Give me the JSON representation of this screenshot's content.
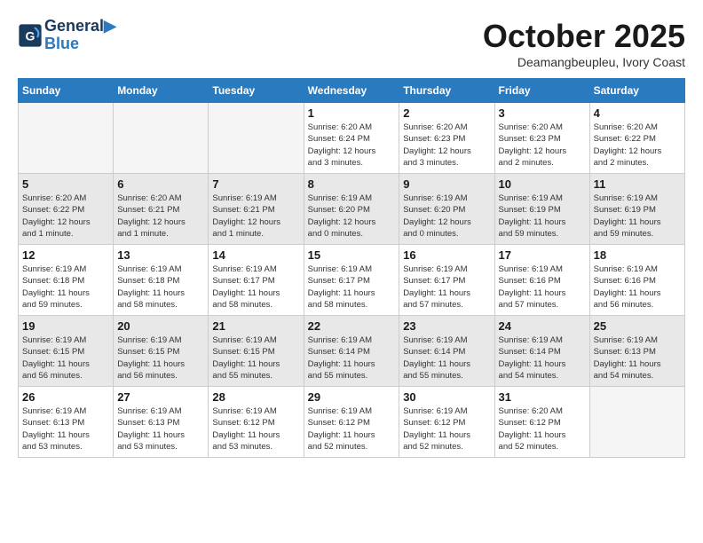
{
  "logo": {
    "line1": "General",
    "line2": "Blue"
  },
  "title": "October 2025",
  "location": "Deamangbeupleu, Ivory Coast",
  "headers": [
    "Sunday",
    "Monday",
    "Tuesday",
    "Wednesday",
    "Thursday",
    "Friday",
    "Saturday"
  ],
  "weeks": [
    [
      {
        "day": "",
        "text": ""
      },
      {
        "day": "",
        "text": ""
      },
      {
        "day": "",
        "text": ""
      },
      {
        "day": "1",
        "text": "Sunrise: 6:20 AM\nSunset: 6:24 PM\nDaylight: 12 hours\nand 3 minutes."
      },
      {
        "day": "2",
        "text": "Sunrise: 6:20 AM\nSunset: 6:23 PM\nDaylight: 12 hours\nand 3 minutes."
      },
      {
        "day": "3",
        "text": "Sunrise: 6:20 AM\nSunset: 6:23 PM\nDaylight: 12 hours\nand 2 minutes."
      },
      {
        "day": "4",
        "text": "Sunrise: 6:20 AM\nSunset: 6:22 PM\nDaylight: 12 hours\nand 2 minutes."
      }
    ],
    [
      {
        "day": "5",
        "text": "Sunrise: 6:20 AM\nSunset: 6:22 PM\nDaylight: 12 hours\nand 1 minute."
      },
      {
        "day": "6",
        "text": "Sunrise: 6:20 AM\nSunset: 6:21 PM\nDaylight: 12 hours\nand 1 minute."
      },
      {
        "day": "7",
        "text": "Sunrise: 6:19 AM\nSunset: 6:21 PM\nDaylight: 12 hours\nand 1 minute."
      },
      {
        "day": "8",
        "text": "Sunrise: 6:19 AM\nSunset: 6:20 PM\nDaylight: 12 hours\nand 0 minutes."
      },
      {
        "day": "9",
        "text": "Sunrise: 6:19 AM\nSunset: 6:20 PM\nDaylight: 12 hours\nand 0 minutes."
      },
      {
        "day": "10",
        "text": "Sunrise: 6:19 AM\nSunset: 6:19 PM\nDaylight: 11 hours\nand 59 minutes."
      },
      {
        "day": "11",
        "text": "Sunrise: 6:19 AM\nSunset: 6:19 PM\nDaylight: 11 hours\nand 59 minutes."
      }
    ],
    [
      {
        "day": "12",
        "text": "Sunrise: 6:19 AM\nSunset: 6:18 PM\nDaylight: 11 hours\nand 59 minutes."
      },
      {
        "day": "13",
        "text": "Sunrise: 6:19 AM\nSunset: 6:18 PM\nDaylight: 11 hours\nand 58 minutes."
      },
      {
        "day": "14",
        "text": "Sunrise: 6:19 AM\nSunset: 6:17 PM\nDaylight: 11 hours\nand 58 minutes."
      },
      {
        "day": "15",
        "text": "Sunrise: 6:19 AM\nSunset: 6:17 PM\nDaylight: 11 hours\nand 58 minutes."
      },
      {
        "day": "16",
        "text": "Sunrise: 6:19 AM\nSunset: 6:17 PM\nDaylight: 11 hours\nand 57 minutes."
      },
      {
        "day": "17",
        "text": "Sunrise: 6:19 AM\nSunset: 6:16 PM\nDaylight: 11 hours\nand 57 minutes."
      },
      {
        "day": "18",
        "text": "Sunrise: 6:19 AM\nSunset: 6:16 PM\nDaylight: 11 hours\nand 56 minutes."
      }
    ],
    [
      {
        "day": "19",
        "text": "Sunrise: 6:19 AM\nSunset: 6:15 PM\nDaylight: 11 hours\nand 56 minutes."
      },
      {
        "day": "20",
        "text": "Sunrise: 6:19 AM\nSunset: 6:15 PM\nDaylight: 11 hours\nand 56 minutes."
      },
      {
        "day": "21",
        "text": "Sunrise: 6:19 AM\nSunset: 6:15 PM\nDaylight: 11 hours\nand 55 minutes."
      },
      {
        "day": "22",
        "text": "Sunrise: 6:19 AM\nSunset: 6:14 PM\nDaylight: 11 hours\nand 55 minutes."
      },
      {
        "day": "23",
        "text": "Sunrise: 6:19 AM\nSunset: 6:14 PM\nDaylight: 11 hours\nand 55 minutes."
      },
      {
        "day": "24",
        "text": "Sunrise: 6:19 AM\nSunset: 6:14 PM\nDaylight: 11 hours\nand 54 minutes."
      },
      {
        "day": "25",
        "text": "Sunrise: 6:19 AM\nSunset: 6:13 PM\nDaylight: 11 hours\nand 54 minutes."
      }
    ],
    [
      {
        "day": "26",
        "text": "Sunrise: 6:19 AM\nSunset: 6:13 PM\nDaylight: 11 hours\nand 53 minutes."
      },
      {
        "day": "27",
        "text": "Sunrise: 6:19 AM\nSunset: 6:13 PM\nDaylight: 11 hours\nand 53 minutes."
      },
      {
        "day": "28",
        "text": "Sunrise: 6:19 AM\nSunset: 6:12 PM\nDaylight: 11 hours\nand 53 minutes."
      },
      {
        "day": "29",
        "text": "Sunrise: 6:19 AM\nSunset: 6:12 PM\nDaylight: 11 hours\nand 52 minutes."
      },
      {
        "day": "30",
        "text": "Sunrise: 6:19 AM\nSunset: 6:12 PM\nDaylight: 11 hours\nand 52 minutes."
      },
      {
        "day": "31",
        "text": "Sunrise: 6:20 AM\nSunset: 6:12 PM\nDaylight: 11 hours\nand 52 minutes."
      },
      {
        "day": "",
        "text": ""
      }
    ]
  ]
}
